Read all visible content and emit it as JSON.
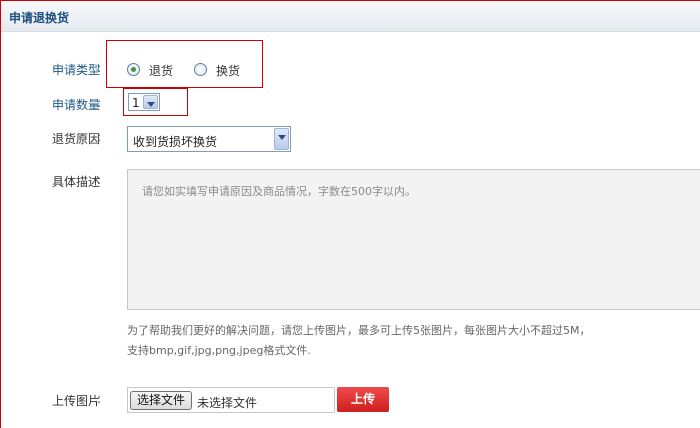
{
  "header": {
    "title": "申请退换货"
  },
  "form": {
    "type": {
      "label": "申请类型",
      "colon": ":",
      "options": [
        {
          "label": "退货",
          "checked": true
        },
        {
          "label": "换货",
          "checked": false
        }
      ]
    },
    "quantity": {
      "label": "申请数量",
      "colon": ":",
      "value": "1"
    },
    "reason": {
      "label": "退货原因",
      "colon": ":",
      "value": "收到货损坏换货"
    },
    "description": {
      "label": "具体描述",
      "colon": ":",
      "placeholder": "请您如实填写申请原因及商品情况，字数在500字以内。"
    },
    "hint": {
      "line1": "为了帮助我们更好的解决问题，请您上传图片，最多可上传5张图片，每张图片大小不超过5M，",
      "line2": "支持bmp,gif,jpg,png,jpeg格式文件."
    },
    "upload": {
      "label": "上传图片",
      "colon": ":",
      "choose_label": "选择文件",
      "no_file_text": "未选择文件",
      "upload_label": "上传"
    }
  },
  "colors": {
    "accent_red": "#cc0000",
    "label_blue": "#1f5a8a",
    "upload_button": "#d92a2a"
  }
}
